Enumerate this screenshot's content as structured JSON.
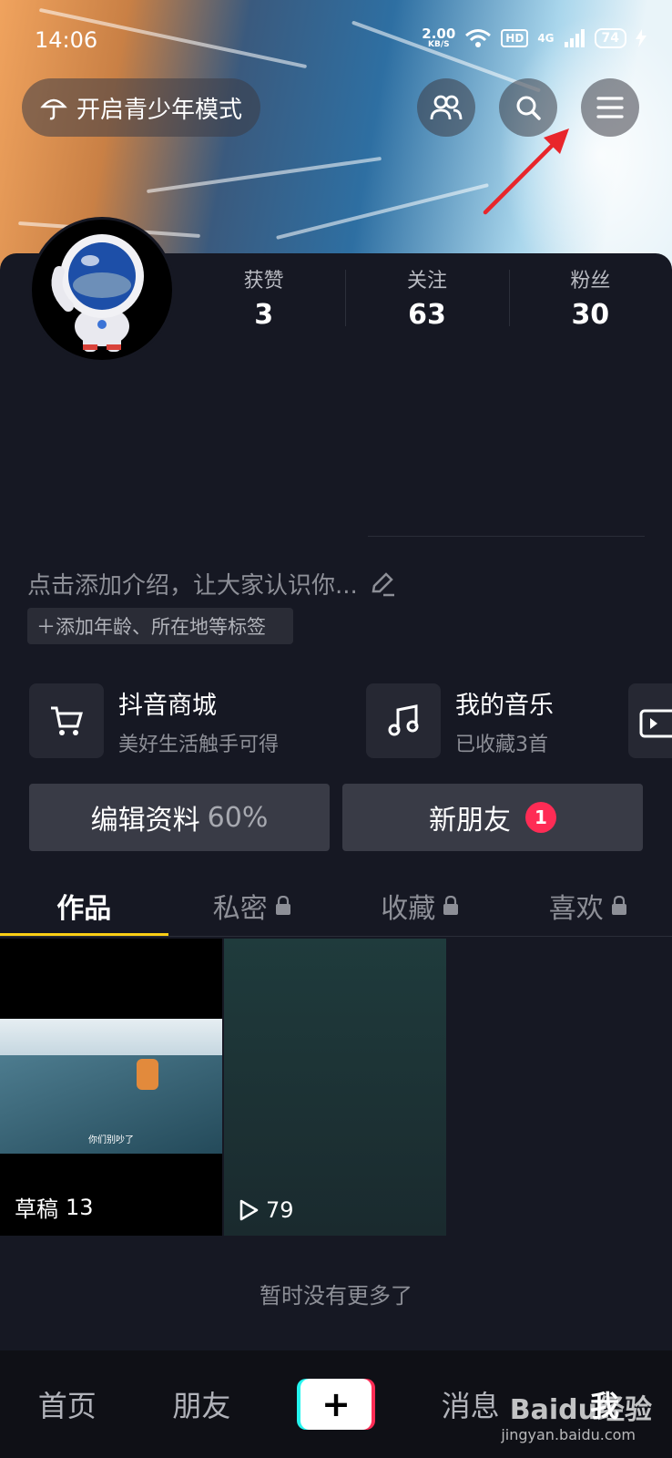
{
  "status_bar": {
    "time": "14:06",
    "net_speed_value": "2.00",
    "net_speed_unit": "KB/S",
    "hd": "HD",
    "network": "4G",
    "battery": "74"
  },
  "header": {
    "youth_mode_label": "开启青少年模式",
    "icons": [
      "friends-icon",
      "search-icon",
      "menu-icon"
    ]
  },
  "stats": [
    {
      "label": "获赞",
      "value": "3"
    },
    {
      "label": "关注",
      "value": "63"
    },
    {
      "label": "粉丝",
      "value": "30"
    }
  ],
  "profile": {
    "intro_placeholder": "点击添加介绍，让大家认识你...",
    "tag_chip": "＋添加年龄、所在地等标签"
  },
  "features": [
    {
      "title": "抖音商城",
      "subtitle": "美好生活触手可得",
      "icon": "cart-icon"
    },
    {
      "title": "我的音乐",
      "subtitle": "已收藏3首",
      "icon": "music-icon"
    }
  ],
  "actions": {
    "edit_label": "编辑资料",
    "edit_percent": "60%",
    "new_friends_label": "新朋友",
    "new_friends_badge": "1"
  },
  "tabs": [
    {
      "label": "作品",
      "locked": false
    },
    {
      "label": "私密",
      "locked": true
    },
    {
      "label": "收藏",
      "locked": true
    },
    {
      "label": "喜欢",
      "locked": true
    }
  ],
  "videos": [
    {
      "caption": "草稿",
      "count": "13",
      "subtitle": "你们别吵了"
    },
    {
      "caption": "",
      "count": "79"
    }
  ],
  "end_text": "暂时没有更多了",
  "bottom_nav": {
    "home": "首页",
    "friends": "朋友",
    "create": "+",
    "messages": "消息",
    "me": "我"
  },
  "watermark": {
    "main": "Baidu经验",
    "sub": "jingyan.baidu.com"
  },
  "colors": {
    "accent": "#face15",
    "badge": "#fe2c55",
    "background": "#161823"
  }
}
